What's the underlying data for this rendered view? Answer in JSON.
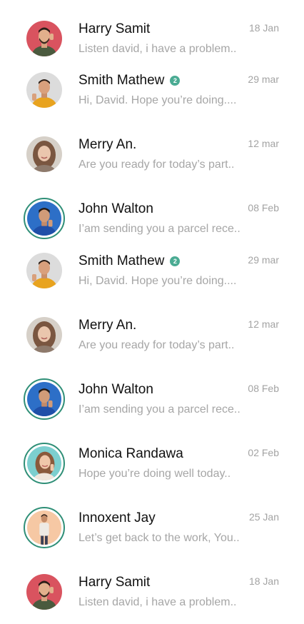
{
  "colors": {
    "ring": "#2f8f77",
    "badge": "#4aab93",
    "name_text": "#111111",
    "muted_text": "#a6a6a6"
  },
  "chats": [
    {
      "name": "Harry Samit",
      "date": "18 Jan",
      "preview": "Listen david, i have a problem..",
      "badge": "",
      "avatar": "man-beard-red-bg"
    },
    {
      "name": "Smith Mathew",
      "date": "29 mar",
      "preview": "Hi, David. Hope you’re doing....",
      "badge": "2",
      "avatar": "man-yellow-shirt"
    },
    {
      "name": "Merry An.",
      "date": "12 mar",
      "preview": "Are you ready for today’s part..",
      "badge": "",
      "avatar": "woman-smiling"
    },
    {
      "name": "John Walton",
      "date": "08 Feb",
      "preview": "I’am sending you a parcel rece..",
      "badge": "",
      "avatar": "man-blue-bg"
    },
    {
      "name": "Smith Mathew",
      "date": "29 mar",
      "preview": "Hi, David. Hope you’re doing....",
      "badge": "2",
      "avatar": "man-yellow-shirt"
    },
    {
      "name": "Merry An.",
      "date": "12 mar",
      "preview": "Are you ready for today’s part..",
      "badge": "",
      "avatar": "woman-smiling"
    },
    {
      "name": "John Walton",
      "date": "08 Feb",
      "preview": "I’am sending you a parcel rece..",
      "badge": "",
      "avatar": "man-blue-bg"
    },
    {
      "name": "Monica Randawa",
      "date": "02 Feb",
      "preview": "Hope you’re doing well today..",
      "badge": "",
      "avatar": "woman-teal-bg"
    },
    {
      "name": "Innoxent Jay",
      "date": "25 Jan",
      "preview": "Let’s get back to the work, You..",
      "badge": "",
      "avatar": "man-standing-peach-bg"
    },
    {
      "name": "Harry Samit",
      "date": "18 Jan",
      "preview": "Listen david, i have a problem..",
      "badge": "",
      "avatar": "man-beard-red-bg"
    }
  ]
}
